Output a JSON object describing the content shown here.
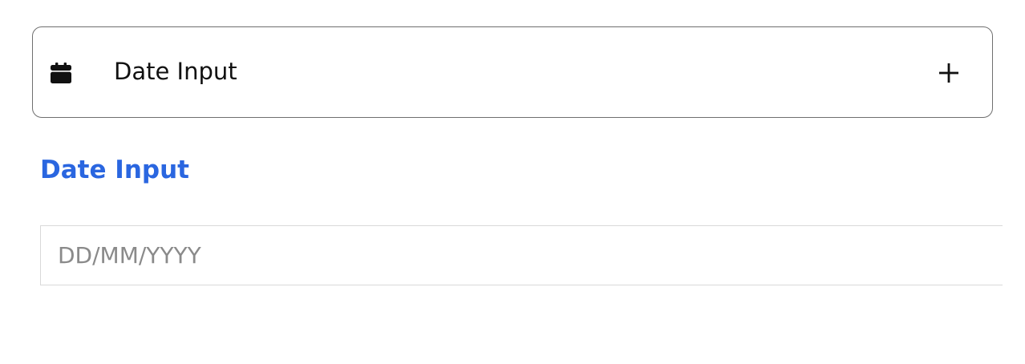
{
  "accordion": {
    "icon": "calendar-icon",
    "title": "Date Input",
    "toggle_icon": "plus-icon"
  },
  "field": {
    "label": "Date Input",
    "label_color": "#2a66e0",
    "placeholder": "DD/MM/YYYY",
    "value": ""
  }
}
